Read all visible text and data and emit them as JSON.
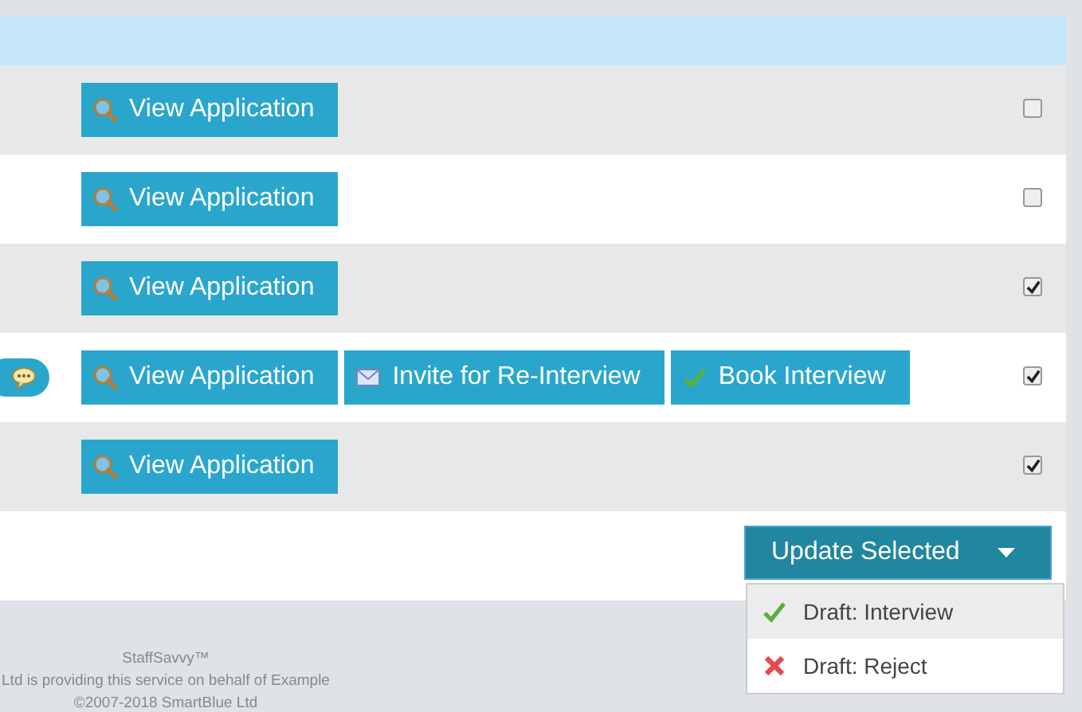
{
  "rows": [
    {
      "comment": false,
      "actions": [
        {
          "kind": "search",
          "label": "View Application"
        }
      ],
      "checked": false
    },
    {
      "comment": false,
      "actions": [
        {
          "kind": "search",
          "label": "View Application"
        }
      ],
      "checked": false
    },
    {
      "comment": false,
      "actions": [
        {
          "kind": "search",
          "label": "View Application"
        }
      ],
      "checked": true
    },
    {
      "comment": true,
      "actions": [
        {
          "kind": "search",
          "label": "View Application"
        },
        {
          "kind": "mail",
          "label": "Invite for Re-Interview"
        },
        {
          "kind": "check",
          "label": "Book Interview"
        }
      ],
      "checked": true
    },
    {
      "comment": false,
      "actions": [
        {
          "kind": "search",
          "label": "View Application"
        }
      ],
      "checked": true
    }
  ],
  "update_button": {
    "label": "Update Selected"
  },
  "dropdown": [
    {
      "kind": "check",
      "label": "Draft: Interview",
      "selected": true
    },
    {
      "kind": "cross",
      "label": "Draft: Reject",
      "selected": false
    }
  ],
  "footer": [
    "StaffSavvy™",
    "Ltd is providing this service on behalf of Example",
    "©2007-2018 SmartBlue Ltd"
  ]
}
